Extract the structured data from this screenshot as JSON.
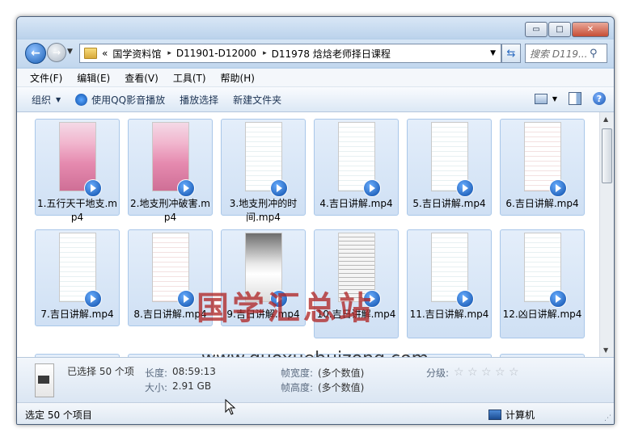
{
  "window": {
    "buttons": {
      "minimize": "▭",
      "maximize": "□",
      "close": "✕"
    }
  },
  "address": {
    "chevron": "«",
    "crumbs": [
      "国学资料馆",
      "D11901-D12000",
      "D11978 焓焓老师择日课程"
    ],
    "separator": "▸",
    "search_placeholder": "搜索 D119..."
  },
  "menu": [
    "文件(F)",
    "编辑(E)",
    "查看(V)",
    "工具(T)",
    "帮助(H)"
  ],
  "toolbar": {
    "organize": "组织",
    "play_qq": "使用QQ影音播放",
    "play_select": "播放选择",
    "new_folder": "新建文件夹",
    "help_symbol": "?"
  },
  "files": [
    {
      "label": "1.五行天干地支.mp4",
      "thumb": "phone"
    },
    {
      "label": "2.地支刑冲破害.mp4",
      "thumb": "phone"
    },
    {
      "label": "3.地支刑冲的时间.mp4",
      "thumb": "doc"
    },
    {
      "label": "4.吉日讲解.mp4",
      "thumb": "doc"
    },
    {
      "label": "5.吉日讲解.mp4",
      "thumb": "doc"
    },
    {
      "label": "6.吉日讲解.mp4",
      "thumb": "docred"
    },
    {
      "label": "7.吉日讲解.mp4",
      "thumb": "doc"
    },
    {
      "label": "8.吉日讲解.mp4",
      "thumb": "docred"
    },
    {
      "label": "9.吉日讲解.mp4",
      "thumb": "dark"
    },
    {
      "label": "10.吉日讲解.mp4",
      "thumb": "grid"
    },
    {
      "label": "11.吉日讲解.mp4",
      "thumb": "doc"
    },
    {
      "label": "12.凶日讲解.mp4",
      "thumb": "doc"
    }
  ],
  "watermark": {
    "cn": "国学汇总站",
    "url": "www.guoxuehuizong.com"
  },
  "details": {
    "selected": "已选择 50 个项",
    "length_label": "长度:",
    "length_value": "08:59:13",
    "size_label": "大小:",
    "size_value": "2.91 GB",
    "width_label": "帧宽度:",
    "width_value": "(多个数值)",
    "height_label": "帧高度:",
    "height_value": "(多个数值)",
    "rating_label": "分级:",
    "rating_stars": 0
  },
  "status": {
    "left": "选定 50 个项目",
    "right": "计算机"
  },
  "colors": {
    "window_frame": "#b9d1ea",
    "tile_selected": "#cfe0f4",
    "watermark_red": "#af2828"
  }
}
